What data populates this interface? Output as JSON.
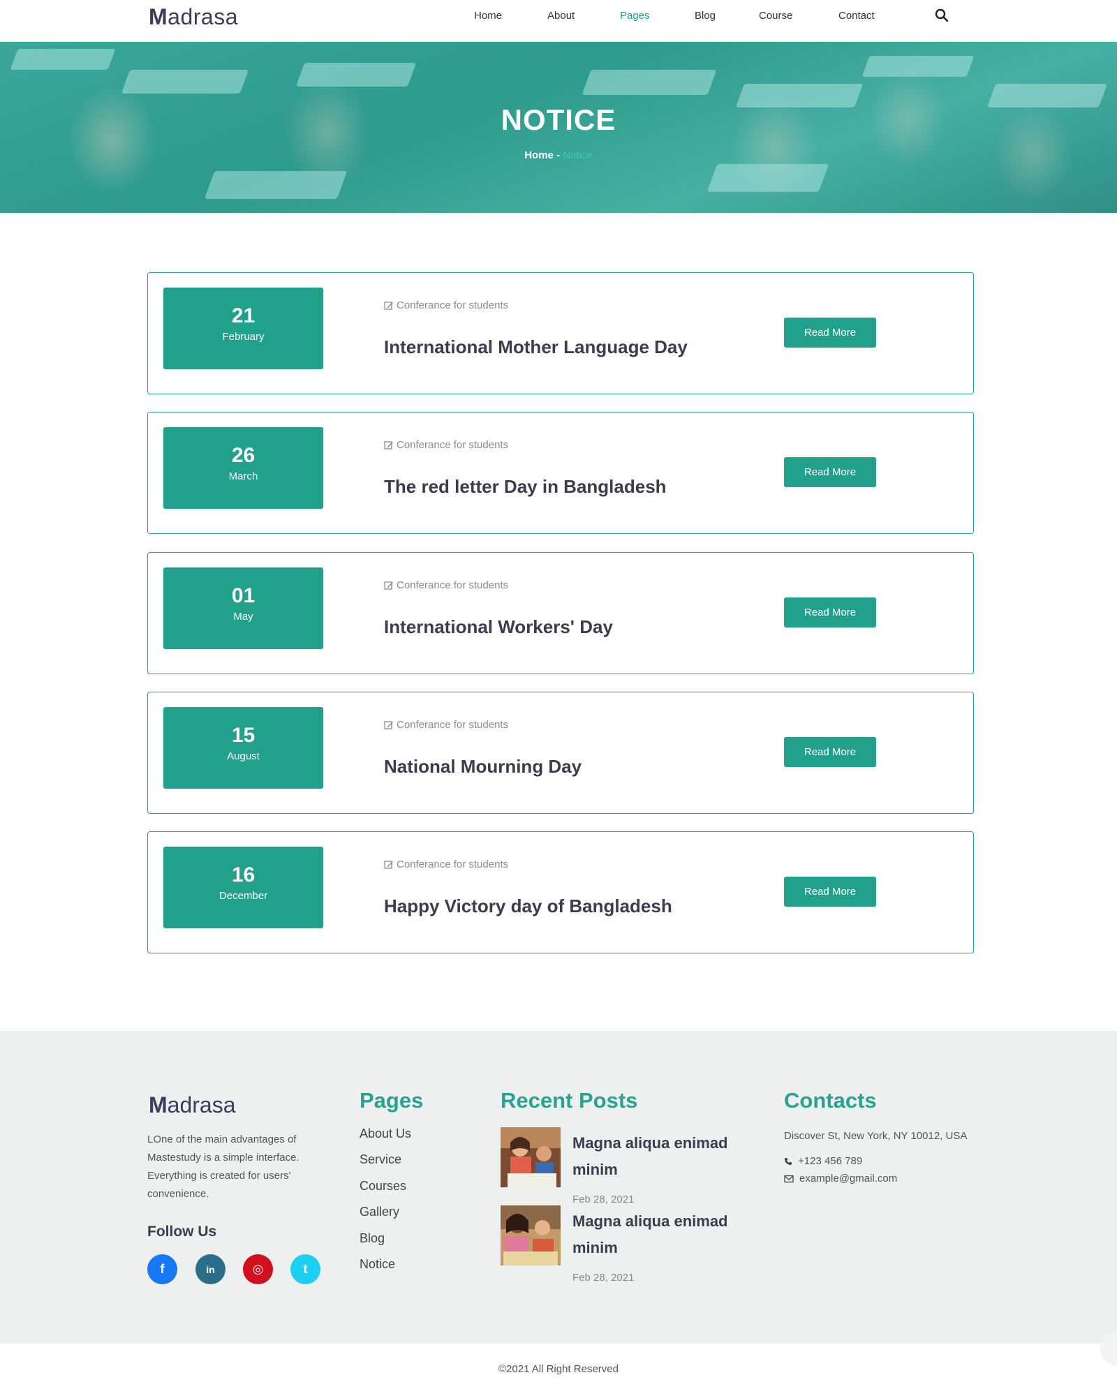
{
  "header": {
    "logo_strong": "M",
    "logo_rest": "adrasa",
    "nav": [
      "Home",
      "About",
      "Pages",
      "Blog",
      "Course",
      "Contact"
    ],
    "active_nav": "Pages",
    "search_icon": "search-icon"
  },
  "hero": {
    "title": "NOTICE",
    "crumb_home": "Home",
    "crumb_sep": " - ",
    "crumb_current": "Notice"
  },
  "notices": [
    {
      "day": "21",
      "month": "February",
      "meta": "Conferance for students",
      "title": "International Mother Language Day",
      "button": "Read More"
    },
    {
      "day": "26",
      "month": "March",
      "meta": "Conferance for students",
      "title": "The red letter Day in Bangladesh",
      "button": "Read More"
    },
    {
      "day": "01",
      "month": "May",
      "meta": "Conferance for students",
      "title": "International Workers' Day",
      "button": "Read More"
    },
    {
      "day": "15",
      "month": "August",
      "meta": "Conferance for students",
      "title": "National Mourning Day",
      "button": "Read More"
    },
    {
      "day": "16",
      "month": "December",
      "meta": "Conferance for students",
      "title": "Happy Victory day of Bangladesh",
      "button": "Read More"
    }
  ],
  "footer": {
    "logo_strong": "M",
    "logo_rest": "adrasa",
    "about": "LOne of the main advantages of Mastestudy is a simple interface. Everything is created for users' convenience.",
    "follow": "Follow Us",
    "socials": [
      {
        "name": "facebook-icon",
        "glyph": "f",
        "color": "#1877f2"
      },
      {
        "name": "linkedin-icon",
        "glyph": "in",
        "color": "#2b6e8a"
      },
      {
        "name": "instagram-icon",
        "glyph": "◎",
        "color": "#d0101c"
      },
      {
        "name": "twitter-icon",
        "glyph": "t",
        "color": "#1dd0f2"
      }
    ],
    "pages_head": "Pages",
    "pages": [
      "About Us",
      "Service",
      "Courses",
      "Gallery",
      "Blog",
      "Notice"
    ],
    "recent_head": "Recent Posts",
    "posts": [
      {
        "title": "Magna aliqua enimad minim",
        "date": "Feb 28, 2021"
      },
      {
        "title": "Magna aliqua enimad minim",
        "date": "Feb 28, 2021"
      }
    ],
    "contacts_head": "Contacts",
    "address": "Discover St, New York, NY 10012, USA",
    "phone": "+123 456 789",
    "email": "example@gmail.com",
    "copyright": "©2021 All Right Reserved"
  },
  "colors": {
    "accent": "#21a08c",
    "heading": "#3b3d4e"
  }
}
